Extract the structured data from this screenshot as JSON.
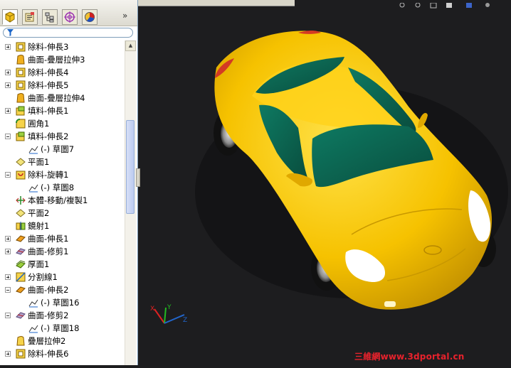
{
  "feature_tree": {
    "filter_icon": "funnel-icon",
    "items": [
      {
        "label": "除料-伸長3",
        "icon": "cut-extrude-icon",
        "expander": "plus",
        "indent": 0
      },
      {
        "label": "曲面-疊層拉伸3",
        "icon": "surface-loft-icon",
        "expander": "none",
        "indent": 0
      },
      {
        "label": "除料-伸長4",
        "icon": "cut-extrude-icon",
        "expander": "plus",
        "indent": 0
      },
      {
        "label": "除料-伸長5",
        "icon": "cut-extrude-icon",
        "expander": "plus",
        "indent": 0
      },
      {
        "label": "曲面-疊層拉伸4",
        "icon": "surface-loft-icon",
        "expander": "none",
        "indent": 0
      },
      {
        "label": "填料-伸長1",
        "icon": "boss-extrude-icon",
        "expander": "plus",
        "indent": 0
      },
      {
        "label": "圓角1",
        "icon": "fillet-icon",
        "expander": "none",
        "indent": 0
      },
      {
        "label": "填料-伸長2",
        "icon": "boss-extrude-icon",
        "expander": "minus",
        "indent": 0
      },
      {
        "label": "(-) 草圖7",
        "icon": "sketch-icon",
        "expander": "none",
        "indent": 1
      },
      {
        "label": "平面1",
        "icon": "plane-icon",
        "expander": "none",
        "indent": 0
      },
      {
        "label": "除料-旋轉1",
        "icon": "revolve-cut-icon",
        "expander": "minus",
        "indent": 0
      },
      {
        "label": "(-) 草圖8",
        "icon": "sketch-icon",
        "expander": "none",
        "indent": 1
      },
      {
        "label": "本體-移動/複製1",
        "icon": "move-body-icon",
        "expander": "none",
        "indent": 0
      },
      {
        "label": "平面2",
        "icon": "plane-icon",
        "expander": "none",
        "indent": 0
      },
      {
        "label": "鏡射1",
        "icon": "mirror-icon",
        "expander": "none",
        "indent": 0
      },
      {
        "label": "曲面-伸長1",
        "icon": "surface-extrude-icon",
        "expander": "plus",
        "indent": 0
      },
      {
        "label": "曲面-修剪1",
        "icon": "surface-trim-icon",
        "expander": "plus",
        "indent": 0
      },
      {
        "label": "厚面1",
        "icon": "thicken-icon",
        "expander": "none",
        "indent": 0
      },
      {
        "label": "分割線1",
        "icon": "split-line-icon",
        "expander": "plus",
        "indent": 0
      },
      {
        "label": "曲面-伸長2",
        "icon": "surface-extrude-icon",
        "expander": "minus",
        "indent": 0
      },
      {
        "label": "(-) 草圖16",
        "icon": "sketch-icon",
        "expander": "none",
        "indent": 1
      },
      {
        "label": "曲面-修剪2",
        "icon": "surface-trim-icon",
        "expander": "minus",
        "indent": 0
      },
      {
        "label": "(-) 草圖18",
        "icon": "sketch-icon",
        "expander": "none",
        "indent": 1
      },
      {
        "label": "疊層拉伸2",
        "icon": "loft-icon",
        "expander": "none",
        "indent": 0
      },
      {
        "label": "除料-伸長6",
        "icon": "cut-extrude-icon",
        "expander": "plus",
        "indent": 0
      }
    ]
  },
  "tabs": [
    {
      "name": "feature-manager-tab",
      "icon": "feature-tree-icon"
    },
    {
      "name": "property-manager-tab",
      "icon": "property-icon"
    },
    {
      "name": "configuration-manager-tab",
      "icon": "configuration-icon"
    },
    {
      "name": "dimxpert-manager-tab",
      "icon": "target-icon"
    },
    {
      "name": "display-manager-tab",
      "icon": "appearance-icon"
    }
  ],
  "more_tabs_glyph": "»",
  "colors": {
    "viewport_bg": "#1d1d1f",
    "car_body": "#f7c600",
    "car_glass": "#0f6b55",
    "panel_bg": "#ffffff",
    "watermark": "#e8222c"
  },
  "watermark": "三維網www.3dportal.cn",
  "triad": {
    "x": "X",
    "y": "Y",
    "z": "Z"
  }
}
